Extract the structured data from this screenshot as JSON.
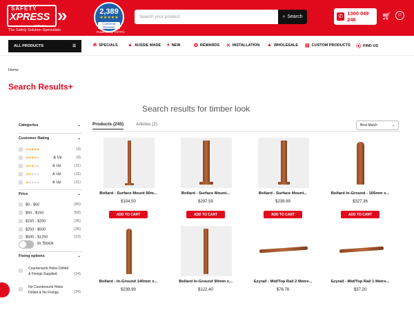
{
  "header": {
    "logo_line1": "SAFETY",
    "logo_line2": "XPRESS",
    "logo_line3": ".com.au",
    "tagline": "The Safety Solution Specialists",
    "review_count": "2,389",
    "review_stars": "★★★★★",
    "review_label": "Customer Reviews",
    "review_powered": "Powered by YOTPO",
    "search_placeholder": "Search your product",
    "search_button": "Search",
    "phone": "1300 049 246",
    "brand_color": "#e10a1d"
  },
  "nav": {
    "all_products": "ALL PRODUCTS",
    "items": [
      {
        "label": "SPECIALS",
        "icon": "flame-icon"
      },
      {
        "label": "AUSSIE MADE",
        "icon": "triangle-icon"
      },
      {
        "label": "NEW",
        "icon": "diamond-icon"
      },
      {
        "label": "REWARDS",
        "icon": "ribbon-icon"
      },
      {
        "label": "INSTALLATION",
        "icon": "tools-icon"
      },
      {
        "label": "WHOLESALE",
        "icon": "triangle-icon"
      },
      {
        "label": "CUSTOM PRODUCTS",
        "icon": "document-icon"
      },
      {
        "label": "FIND US",
        "icon": "location-pin-icon"
      }
    ]
  },
  "breadcrumb": "Home",
  "page_title": "Search Results+",
  "search_title": "Search results for timber look",
  "filters": {
    "categories": "Categories",
    "customer_rating": "Customer Rating",
    "ratings": [
      {
        "stars": 5,
        "suffix": "",
        "count": "(3)"
      },
      {
        "stars": 4,
        "suffix": "& Up",
        "count": "(9)"
      },
      {
        "stars": 3,
        "suffix": "& Up",
        "count": "(11)"
      },
      {
        "stars": 2,
        "suffix": "& Up",
        "count": "(11)"
      },
      {
        "stars": 1,
        "suffix": "& Up",
        "count": "(11)"
      }
    ],
    "price": "Price",
    "prices": [
      {
        "label": "$0 - $50",
        "count": "(95)"
      },
      {
        "label": "$50 - $150",
        "count": "(58)"
      },
      {
        "label": "$150 - $250",
        "count": "(36)"
      },
      {
        "label": "$250 - $500",
        "count": "(36)"
      },
      {
        "label": "$500 - $1250",
        "count": "(13)"
      }
    ],
    "in_stock": "In Stock",
    "fixing_options": "Fixing options",
    "fixings": [
      {
        "label": "Countersunk Holes Drilled & Fixings Supplied",
        "count": "(24)"
      },
      {
        "label": "No Countersunk Holes Drilled & No Fixings",
        "count": "(24)"
      }
    ]
  },
  "tabs": {
    "products": "Products (245)",
    "articles": "Articles (2)"
  },
  "sort": "Best Match",
  "add_to_cart": "ADD TO CART",
  "products": [
    {
      "name": "Bollard - Surface Mount 90m...",
      "price": "$104.50"
    },
    {
      "name": "Bollard - Surface Mount...",
      "price": "$297.59"
    },
    {
      "name": "Bollard - Surface Mount...",
      "price": "$239.99"
    },
    {
      "name": "Bollard In-Ground - 165mm x...",
      "price": "$327.36"
    },
    {
      "name": "Bollard - In-Ground 140mm x...",
      "price": "$239.99"
    },
    {
      "name": "Bollard In-Ground 90mm x...",
      "price": "$122.40"
    },
    {
      "name": "Ezyrail - Mid/Top Rail 2 Metre...",
      "price": "$76.76"
    },
    {
      "name": "Ezyrail - Mid/Top Rail 1 Metre...",
      "price": "$37.20"
    }
  ]
}
